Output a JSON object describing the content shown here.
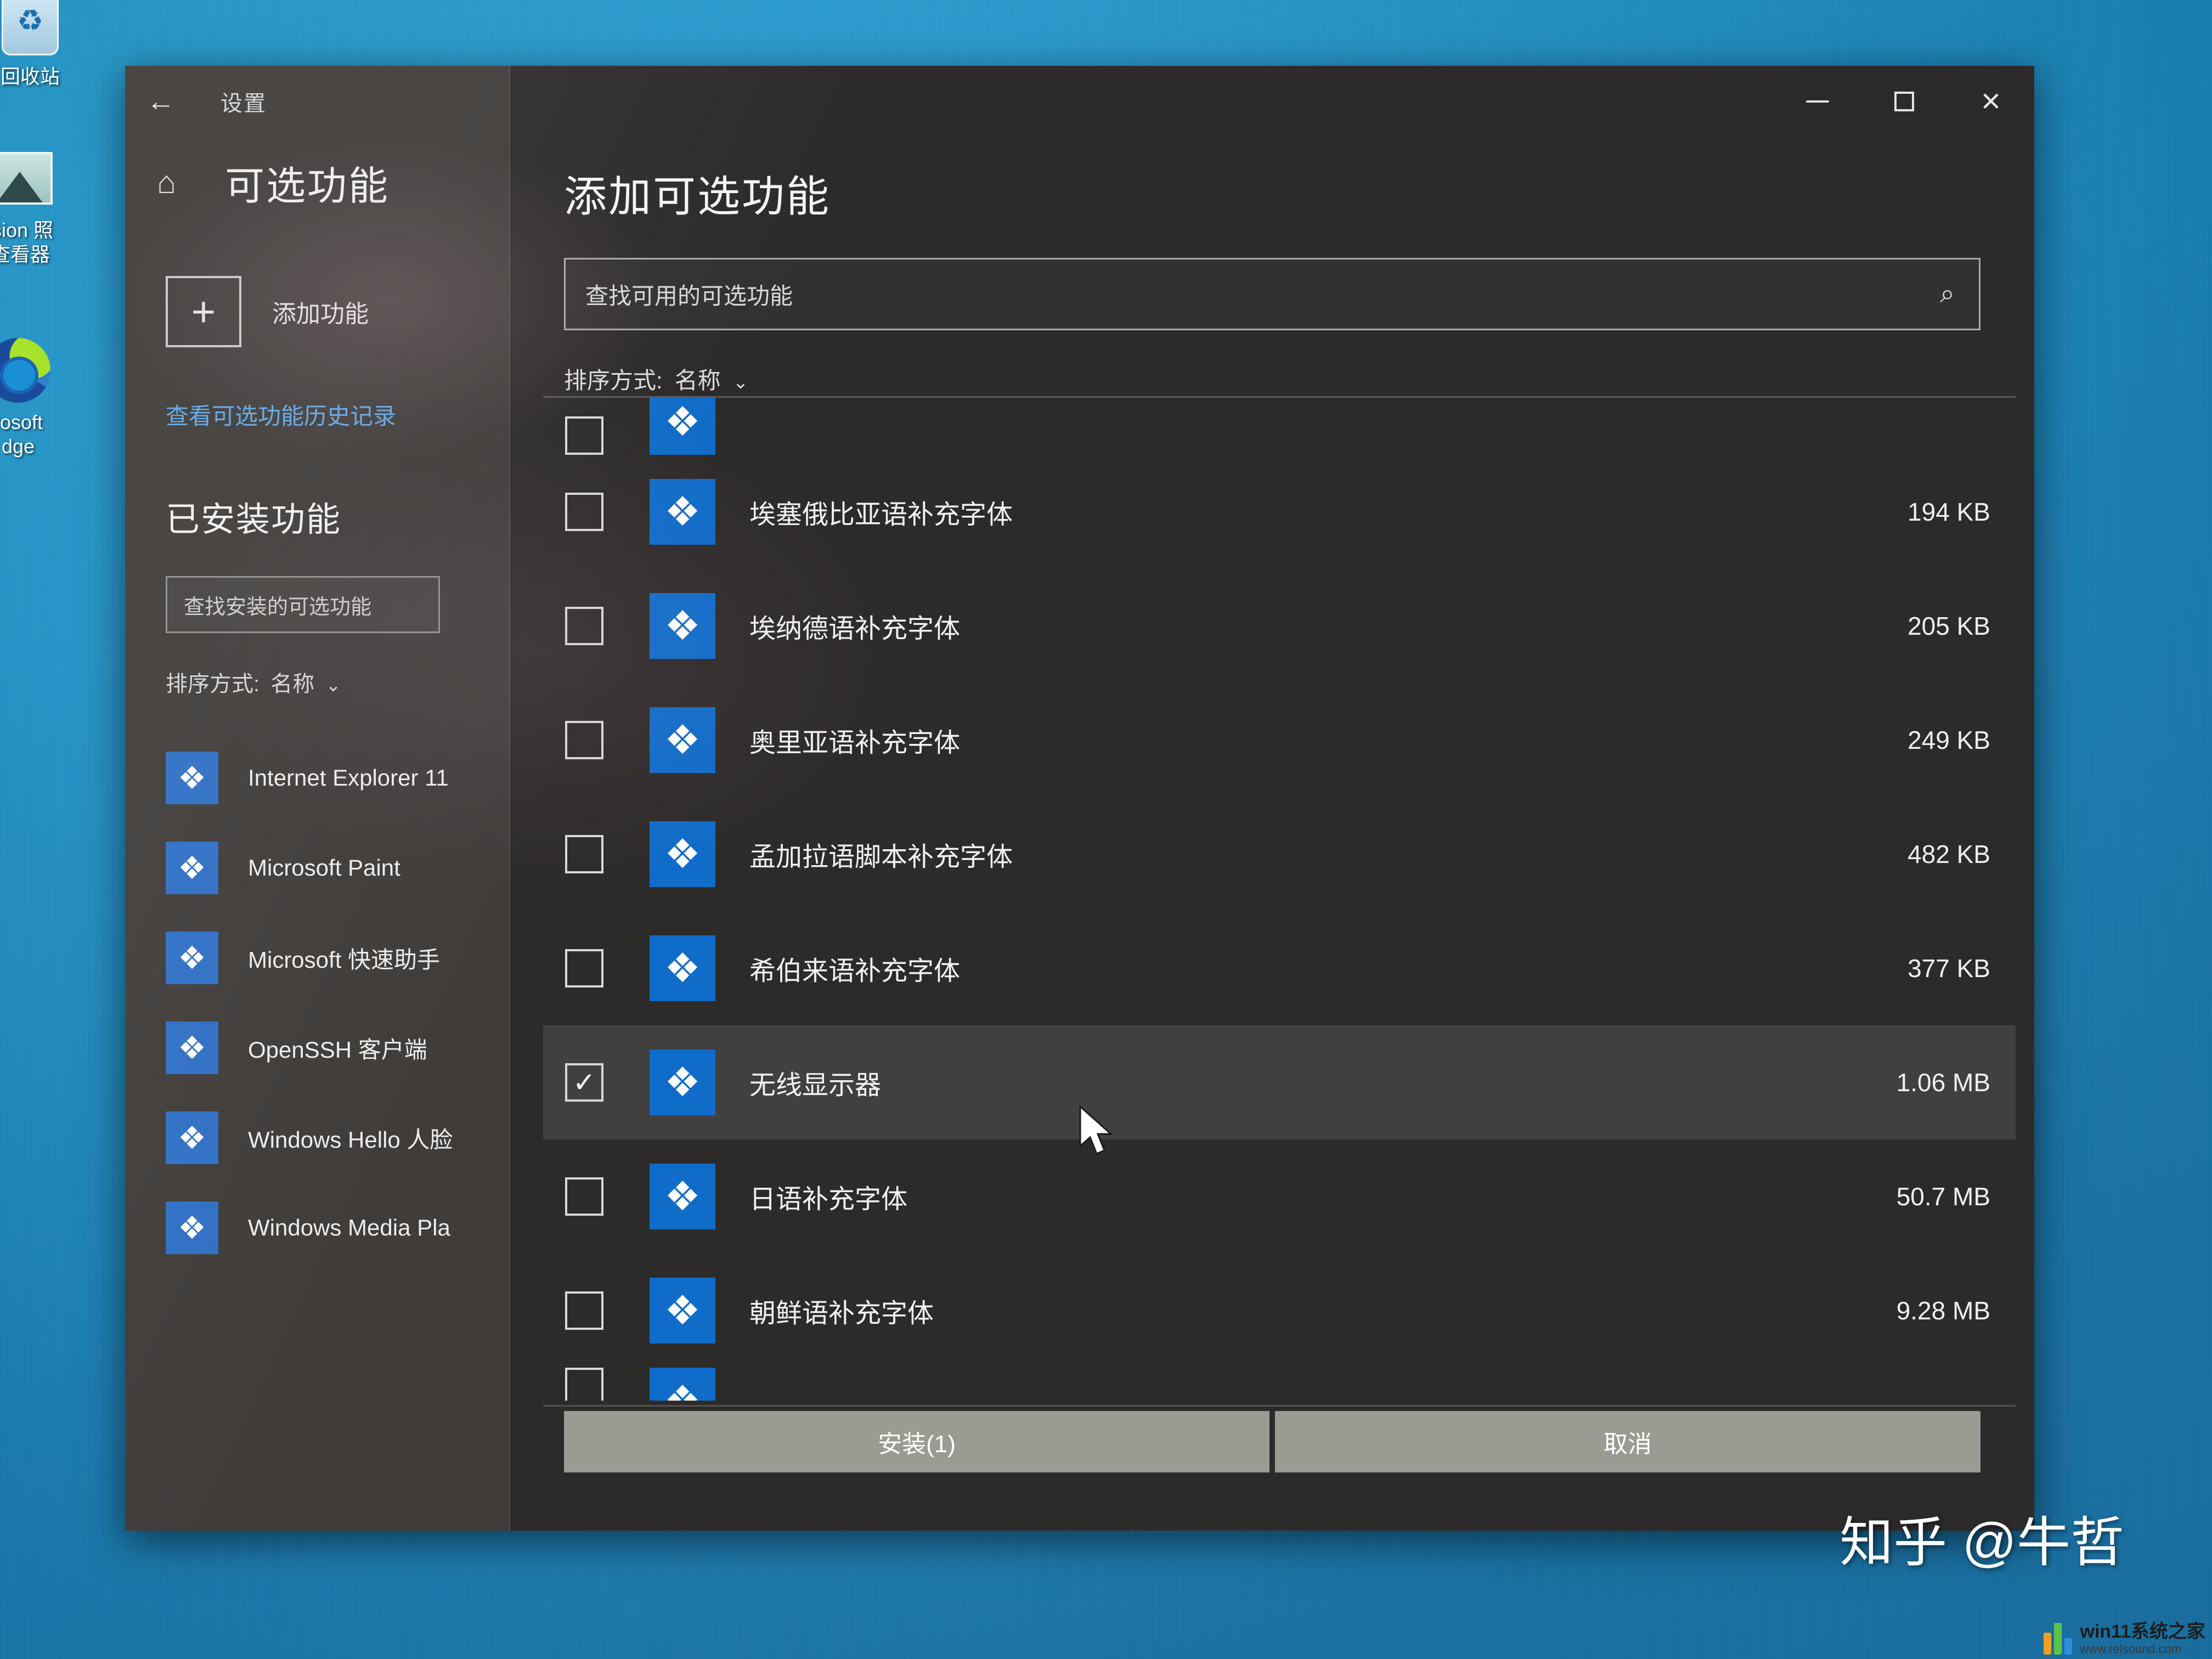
{
  "desktop": {
    "icons": [
      {
        "label": "回收站",
        "glyph": "recycle-bin"
      },
      {
        "label": "ision 照\n查看器",
        "glyph": "photo-viewer"
      },
      {
        "label": "rosoft\ndge",
        "glyph": "edge"
      }
    ],
    "watermark": "知乎 @牛哲",
    "site_logo": {
      "name": "win11系统之家",
      "url": "www.relsound.com"
    }
  },
  "window": {
    "titlebar_label": "设置",
    "back_icon": "←",
    "controls": {
      "minimize": "minimize-icon",
      "maximize": "maximize-icon",
      "close": "×"
    }
  },
  "left_pane": {
    "home_icon": "⌂",
    "title": "可选功能",
    "add_feature": {
      "plus": "+",
      "label": "添加功能"
    },
    "history_link": "查看可选功能历史记录",
    "installed_section_title": "已安装功能",
    "installed_search_placeholder": "查找安装的可选功能",
    "sort_label": "排序方式:",
    "sort_value": "名称",
    "sort_caret": "⌄",
    "installed_items": [
      {
        "name": "Internet Explorer 11"
      },
      {
        "name": "Microsoft Paint"
      },
      {
        "name": "Microsoft 快速助手"
      },
      {
        "name": "OpenSSH 客户端"
      },
      {
        "name": "Windows Hello 人脸"
      },
      {
        "name": "Windows Media Pla"
      }
    ]
  },
  "dialog": {
    "title": "添加可选功能",
    "search_placeholder": "查找可用的可选功能",
    "search_icon": "⌕",
    "sort_label": "排序方式:",
    "sort_value": "名称",
    "sort_caret": "⌄",
    "features": [
      {
        "name": "",
        "size": "",
        "checked": false,
        "clipped": "top"
      },
      {
        "name": "埃塞俄比亚语补充字体",
        "size": "194 KB",
        "checked": false
      },
      {
        "name": "埃纳德语补充字体",
        "size": "205 KB",
        "checked": false
      },
      {
        "name": "奥里亚语补充字体",
        "size": "249 KB",
        "checked": false
      },
      {
        "name": "孟加拉语脚本补充字体",
        "size": "482 KB",
        "checked": false
      },
      {
        "name": "希伯来语补充字体",
        "size": "377 KB",
        "checked": false
      },
      {
        "name": "无线显示器",
        "size": "1.06 MB",
        "checked": true
      },
      {
        "name": "日语补充字体",
        "size": "50.7 MB",
        "checked": false
      },
      {
        "name": "朝鲜语补充字体",
        "size": "9.28 MB",
        "checked": false
      },
      {
        "name": "",
        "size": "",
        "checked": false,
        "clipped": "bottom"
      }
    ],
    "install_button": "安装(1)",
    "cancel_button": "取消"
  },
  "colors": {
    "desktop_blue": "#1c9fdc",
    "accent_blue": "#0f6cc8",
    "link_blue": "#5fa8e8",
    "window_bg": "#3f3c3a",
    "dialog_bg": "#2c2a29",
    "button_gray": "#9b9b93"
  }
}
